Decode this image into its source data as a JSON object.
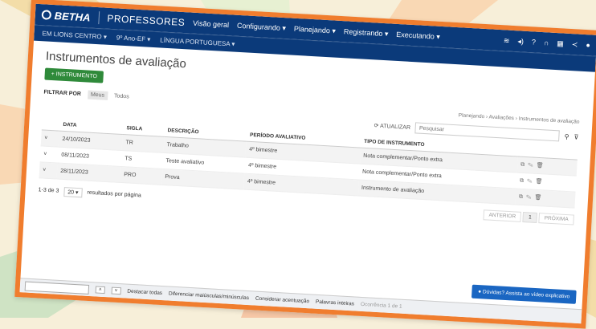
{
  "colors": {
    "brand": "#0b3a7a",
    "frame": "#f07d2e",
    "primary_button": "#2f8a3a",
    "help": "#1a66c2"
  },
  "topbar": {
    "logo": "BETHA",
    "module": "PROFESSORES",
    "nav": [
      "Visão geral",
      "Configurando ▾",
      "Planejando ▾",
      "Registrando ▾",
      "Executando ▾"
    ]
  },
  "subbar": {
    "school": "EM LIONS CENTRO ▾",
    "grade": "9º Ano-EF ▾",
    "subject": "LÍNGUA PORTUGUESA ▾"
  },
  "page": {
    "title": "Instrumentos de avaliação",
    "add_button": "+ INSTRUMENTO",
    "filter_label": "FILTRAR POR",
    "filters": [
      "Meus",
      "Todos"
    ],
    "breadcrumb": "Planejando › Avaliações › Instrumentos de avaliação",
    "refresh_label": "ATUALIZAR",
    "search_placeholder": "Pesquisar"
  },
  "table": {
    "headers": [
      "DATA",
      "SIGLA",
      "DESCRIÇÃO",
      "PERÍODO AVALIATIVO",
      "TIPO DE INSTRUMENTO"
    ],
    "rows": [
      {
        "date": "24/10/2023",
        "code": "TR",
        "description": "Trabalho",
        "period": "4º bimestre",
        "type": "Nota complementar/Ponto extra"
      },
      {
        "date": "08/11/2023",
        "code": "TS",
        "description": "Teste avaliativo",
        "period": "4º bimestre",
        "type": "Nota complementar/Ponto extra"
      },
      {
        "date": "28/11/2023",
        "code": "PRO",
        "description": "Prova",
        "period": "4º bimestre",
        "type": "Instrumento de avaliação"
      }
    ]
  },
  "pager": {
    "count": "1-3 de 3",
    "page_size": "20 ▾",
    "per_page_label": "resultados por página",
    "prev": "ANTERIOR",
    "current": "1",
    "next": "PRÓXIMA"
  },
  "findbar": {
    "highlight_all": "Destacar todas",
    "match_case": "Diferenciar maiúsculas/minúsculas",
    "match_diacritics": "Considerar acentuação",
    "whole_words": "Palavras inteiras",
    "status": "Ocorrência 1 de 1"
  },
  "help_button": "Dúvidas? Assista ao vídeo explicativo"
}
